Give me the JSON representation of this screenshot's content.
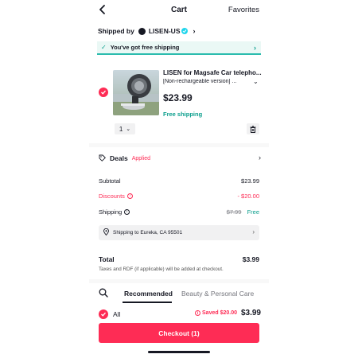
{
  "header": {
    "title": "Cart",
    "favorites_label": "Favorites"
  },
  "shop": {
    "shipped_by_label": "Shipped by",
    "name": "LISEN-US"
  },
  "free_shipping_banner": {
    "text": "You've got free shipping"
  },
  "item": {
    "title": "LISEN for Magsafe Car telepho...",
    "variant": "[Non-rechargeable version] ...",
    "price": "$23.99",
    "shipping": "Free shipping",
    "quantity": "1"
  },
  "deals": {
    "label": "Deals",
    "status": "Applied"
  },
  "summary": {
    "subtotal_label": "Subtotal",
    "subtotal_value": "$23.99",
    "discounts_label": "Discounts",
    "discounts_value": "- $20.00",
    "shipping_label": "Shipping",
    "shipping_original": "$7.99",
    "shipping_value": "Free",
    "ship_to": "Shipping to Eureka, CA 95501"
  },
  "total": {
    "label": "Total",
    "value": "$3.99",
    "tax_note": "Taxes and RDF (if applicable) will be added at checkout."
  },
  "tabs": [
    {
      "label": "Recommended"
    },
    {
      "label": "Beauty & Personal Care"
    }
  ],
  "footer": {
    "all_label": "All",
    "saved_text": "Saved $20.00",
    "total": "$3.99",
    "checkout_label": "Checkout (1)"
  },
  "colors": {
    "accent": "#fe2c55",
    "teal": "#0a9e8c"
  },
  "icons": [
    "back-arrow-icon",
    "verified-icon",
    "chevron-right-icon",
    "check-icon",
    "chevron-down-icon",
    "trash-icon",
    "tag-icon",
    "info-icon",
    "location-pin-icon",
    "search-icon"
  ]
}
